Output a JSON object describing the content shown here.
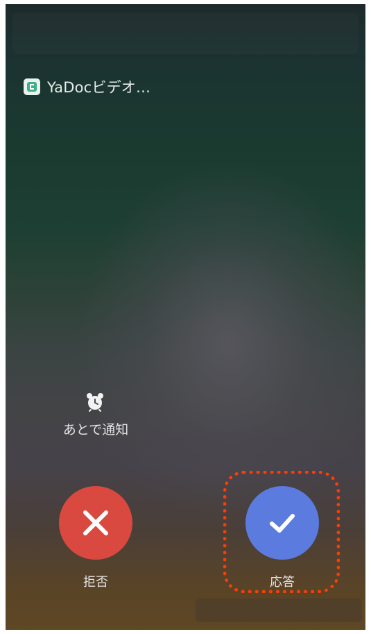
{
  "notification": {
    "app_name": "YaDocビデオ…"
  },
  "actions": {
    "remind_label": "あとで通知",
    "decline_label": "拒否",
    "accept_label": "応答"
  },
  "colors": {
    "decline": "#d9493f",
    "accept": "#5b7bde",
    "highlight": "#ff3b06"
  },
  "icons": {
    "app": "yadoc-app-icon",
    "remind": "alarm-clock-icon",
    "decline": "close-icon",
    "accept": "check-icon"
  }
}
